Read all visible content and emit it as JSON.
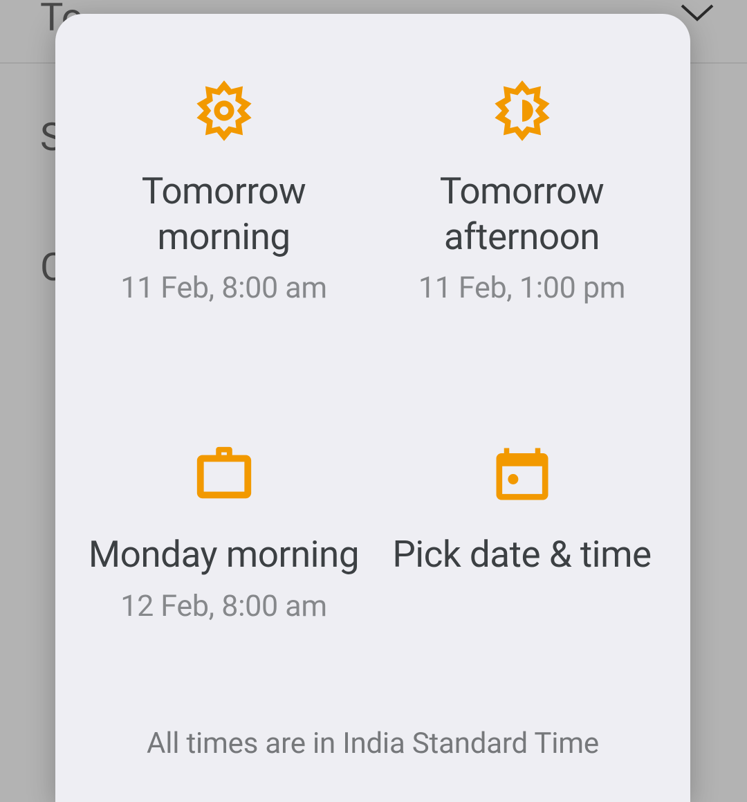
{
  "background": {
    "to_label": "To",
    "s_label": "S",
    "c_label": "C"
  },
  "dialog": {
    "options": [
      {
        "title": "Tomorrow morning",
        "subtitle": "11 Feb, 8:00 am",
        "icon": "sun-full-icon"
      },
      {
        "title": "Tomorrow afternoon",
        "subtitle": "11 Feb, 1:00 pm",
        "icon": "sun-half-icon"
      },
      {
        "title": "Monday morning",
        "subtitle": "12 Feb, 8:00 am",
        "icon": "briefcase-icon"
      },
      {
        "title": "Pick date & time",
        "subtitle": "",
        "icon": "calendar-icon"
      }
    ],
    "footer_note": "All times are in India Standard Time"
  },
  "colors": {
    "accent": "#f29900",
    "text_primary": "#3c4043",
    "text_secondary": "#86888b",
    "dialog_bg": "#eeeef3"
  }
}
